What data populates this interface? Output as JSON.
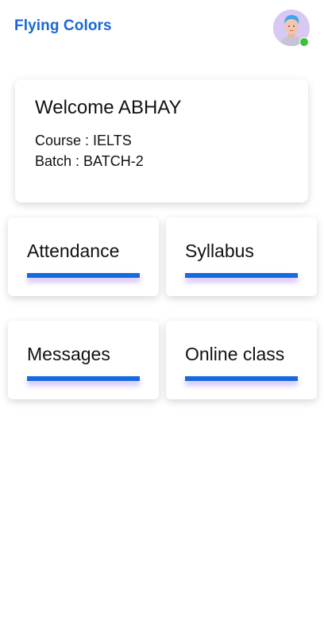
{
  "header": {
    "app_title": "Flying Colors",
    "avatar_status": "online",
    "status_color": "#3cc13b"
  },
  "welcome": {
    "greeting": "Welcome ABHAY",
    "course_line": "Course : IELTS",
    "batch_line": "Batch : BATCH-2"
  },
  "tiles": [
    {
      "label": "Attendance"
    },
    {
      "label": "Syllabus"
    },
    {
      "label": "Messages"
    },
    {
      "label": "Online class"
    }
  ],
  "colors": {
    "accent": "#1769d6",
    "bar_glow": "#8c5af0"
  }
}
